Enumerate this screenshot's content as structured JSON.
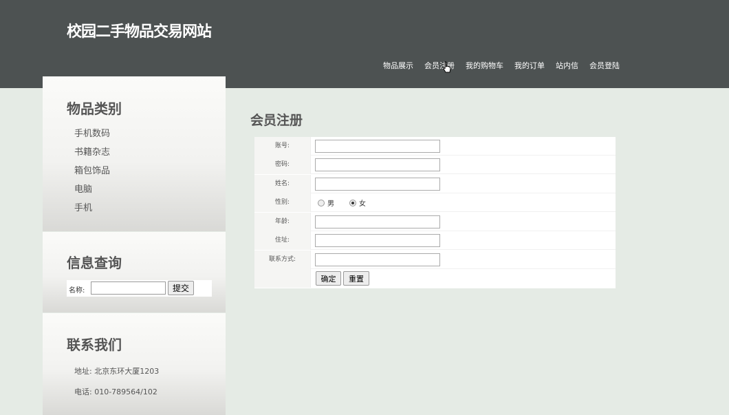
{
  "header": {
    "site_title": "校园二手物品交易网站",
    "nav": [
      "物品展示",
      "会员注册",
      "我的购物车",
      "我的订单",
      "站内信",
      "会员登陆"
    ]
  },
  "sidebar": {
    "categories": {
      "title": "物品类别",
      "items": [
        "手机数码",
        "书籍杂志",
        "箱包饰品",
        "电脑",
        "手机"
      ]
    },
    "search": {
      "title": "信息查询",
      "label": "名称:",
      "value": "",
      "button": "提交"
    },
    "contact": {
      "title": "联系我们",
      "address": "地址: 北京东环大厦1203",
      "phone": "电话: 010-789564/102"
    }
  },
  "main": {
    "title": "会员注册",
    "fields": {
      "account": "账号:",
      "password": "密码:",
      "name": "姓名:",
      "gender": "性别:",
      "age": "年龄:",
      "address": "住址:",
      "contact": "联系方式:"
    },
    "gender_options": {
      "male": "男",
      "female": "女",
      "selected": "女"
    },
    "buttons": {
      "confirm": "确定",
      "reset": "重置"
    }
  },
  "colors": {
    "header_bg": "#4d5252",
    "page_bg": "#e5ebe5"
  }
}
